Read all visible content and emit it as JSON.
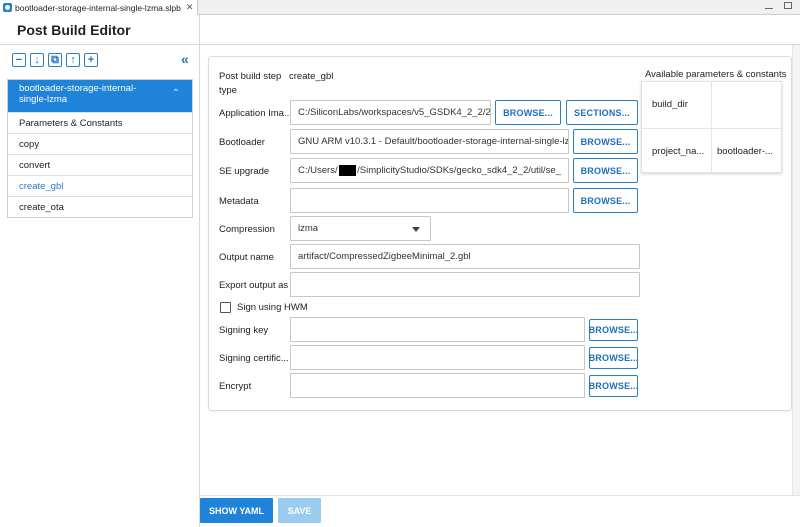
{
  "tab": {
    "title": "bootloader-storage-internal-single-lzma.slpb",
    "close": "✕"
  },
  "page_title": "Post Build Editor",
  "toolbar": {
    "move_up": "−",
    "move_down": "↓",
    "copy": "⧉",
    "up": "↑",
    "add": "+",
    "collapse": "«"
  },
  "steps": {
    "header_line1": "bootloader-storage-internal-",
    "header_line2": "single-lzma",
    "chevron": "⌃",
    "items": [
      "Parameters & Constants",
      "copy",
      "convert",
      "create_gbl",
      "create_ota"
    ]
  },
  "form": {
    "step_type_label_1": "Post build step",
    "step_type_label_2": "type",
    "step_type_value": "create_gbl",
    "application_image_label": "Application Ima...",
    "application_image_value": "C:/SiliconLabs/workspaces/v5_GSDK4_2_2/2",
    "bootloader_label": "Bootloader",
    "bootloader_value": "GNU ARM v10.3.1 - Default/bootloader-storage-internal-single-lz",
    "se_upgrade_label": "SE upgrade",
    "se_upgrade_prefix": "C:/Users/",
    "se_upgrade_suffix": "/SimplicityStudio/SDKs/gecko_sdk4_2_2/util/se_",
    "metadata_label": "Metadata",
    "metadata_value": "",
    "compression_label": "Compression",
    "compression_value": "lzma",
    "output_name_label": "Output name",
    "output_name_value": "artifact/CompressedZigbeeMinimal_2.gbl",
    "export_output_label": "Export output as",
    "export_output_value": "",
    "sign_hwm_label": "Sign using HWM",
    "signing_key_label": "Signing key",
    "signing_key_value": "",
    "signing_cert_label": "Signing certific...",
    "signing_cert_value": "",
    "encrypt_label": "Encrypt",
    "encrypt_value": ""
  },
  "buttons": {
    "browse": "BROWSE...",
    "sections": "SECTIONS...",
    "show_yaml": "SHOW YAML",
    "save": "SAVE"
  },
  "params": {
    "title": "Available parameters & constants",
    "rows": [
      {
        "name": "build_dir",
        "value": ""
      },
      {
        "name": "project_na...",
        "value": "bootloader-..."
      }
    ]
  },
  "colors": {
    "accent": "#1f84d9",
    "outline_button": "#2a7fc4",
    "disabled_button": "#9ccbf0",
    "selected_text": "#2b7cc6"
  }
}
